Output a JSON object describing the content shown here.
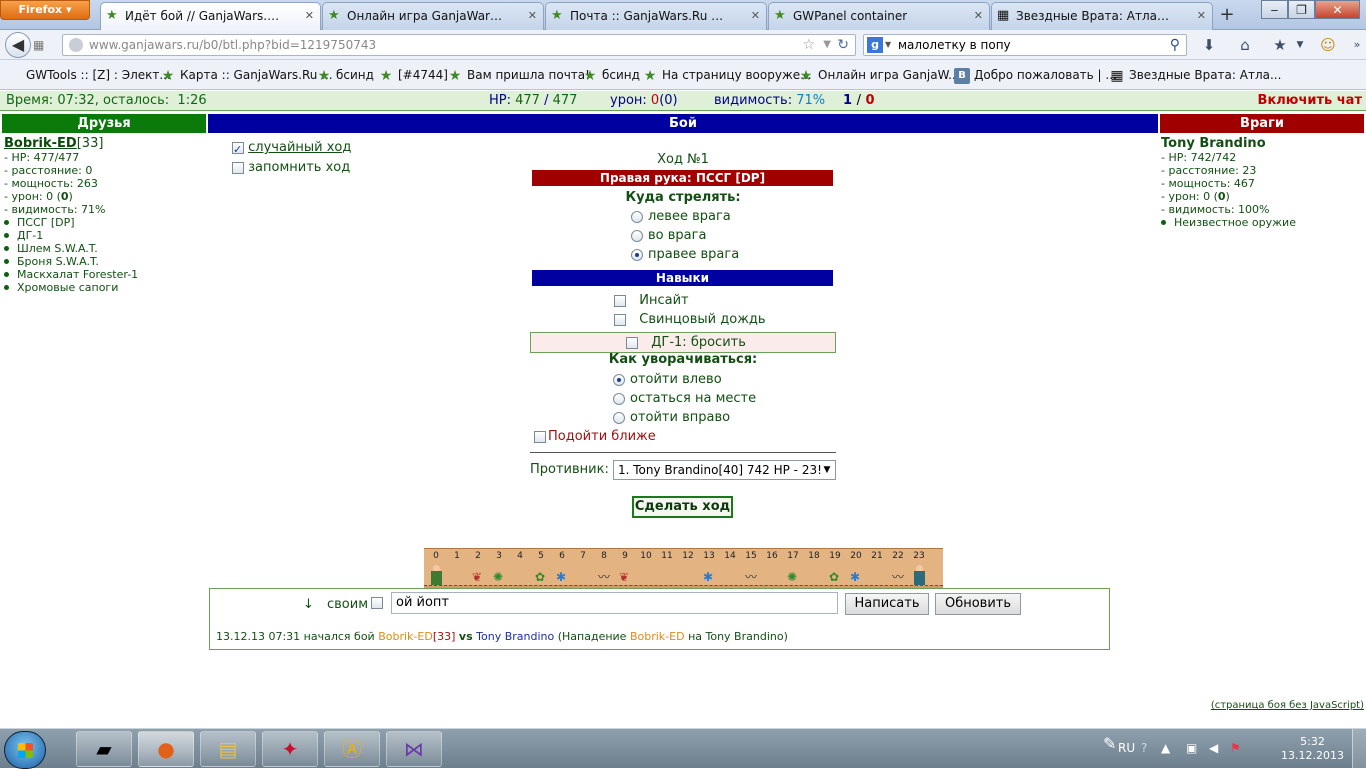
{
  "browser": {
    "menu_button": "Firefox",
    "tabs": [
      {
        "label": "Идёт бой // GanjaWars.Ru",
        "active": true
      },
      {
        "label": "Онлайн игра GanjaWars.Ru :: Г...",
        "active": false
      },
      {
        "label": "Почта :: GanjaWars.Ru :: Гандж...",
        "active": false
      },
      {
        "label": "GWPanel container",
        "active": false
      },
      {
        "label": "Звездные Врата: Атлантида 1,2,...",
        "active": false
      }
    ],
    "url": "www.ganjawars.ru/b0/btl.php?bid=1219750743",
    "search_engine": "g",
    "search_text": "малолетку в попу",
    "bookmarks": [
      {
        "label": "GWTools :: [Z] : Элект...",
        "icon": "page-icon"
      },
      {
        "label": "Карта :: GanjaWars.Ru ...",
        "icon": "star-icon"
      },
      {
        "label": "бсинд",
        "icon": "star-icon"
      },
      {
        "label": "[#4744]",
        "icon": "star-icon"
      },
      {
        "label": "Вам пришла почта!",
        "icon": "star-icon"
      },
      {
        "label": "бсинд",
        "icon": "star-icon"
      },
      {
        "label": "На страницу вооруже...",
        "icon": "star-icon"
      },
      {
        "label": "Онлайн игра GanjaW...",
        "icon": "star-icon"
      },
      {
        "label": "Добро пожаловать | ...",
        "icon": "vk-icon"
      },
      {
        "label": "Звездные Врата: Атла...",
        "icon": "film-icon"
      }
    ]
  },
  "status": {
    "time_label": "Время:",
    "time_value": "07:32",
    "remaining_label": ", осталось:",
    "remaining_value": "1:26",
    "hp_label": "HP:",
    "hp_current": "477",
    "hp_max": "477",
    "damage_label": "урон:",
    "damage_value": "0",
    "damage_extra": "(0)",
    "visibility_label": "видимость:",
    "visibility_value": "71%",
    "team_a": "1",
    "team_b": "0",
    "chat_toggle": "Включить чат"
  },
  "panels": {
    "friends": "Друзья",
    "battle": "Бой",
    "enemies": "Враги"
  },
  "friend": {
    "name": "Bobrik-ED",
    "level": "[33]",
    "stats": [
      "- HP: 477/477",
      "- расстояние: 0",
      "- мощность: 263"
    ],
    "damage": "- урон: 0 (",
    "damage_bold": "0",
    "damage_close": ")",
    "visibility": "- видимость: 71%",
    "items": [
      "ПССГ [DP]",
      "ДГ-1",
      "Шлем S.W.A.T.",
      "Броня S.W.A.T.",
      "Маскхалат Forester-1",
      "Хромовые сапоги"
    ]
  },
  "enemy": {
    "name": "Tony Brandino",
    "stats": [
      "- HP: 742/742",
      "- расстояние: 23",
      "- мощность: 467"
    ],
    "damage": "- урон: 0 (",
    "damage_bold": "0",
    "damage_close": ")",
    "visibility": "- видимость: 100%",
    "items": [
      "Неизвестное оружие"
    ]
  },
  "options": {
    "random_move": "случайный ход",
    "remember_move": "запомнить ход"
  },
  "turn": {
    "title": "Ход №1",
    "right_hand": "Правая рука: ПССГ [DP]",
    "shoot_title": "Куда стрелять:",
    "shoot_options": [
      "левее врага",
      "во врага",
      "правее врага"
    ],
    "shoot_selected": 2,
    "skills_title": "Навыки",
    "skills": [
      "Инсайт",
      "Свинцовый дождь"
    ],
    "grenade": "ДГ-1: бросить",
    "dodge_title": "Как уворачиваться:",
    "dodge_options": [
      "отойти влево",
      "остаться на месте",
      "отойти вправо"
    ],
    "dodge_selected": 0,
    "approach": "Подойти ближе",
    "opponent_label": "Противник:",
    "opponent_value": "1. Tony Brandino[40] 742 HP - 23!",
    "submit": "Сделать ход"
  },
  "field": {
    "cells": [
      "0",
      "1",
      "2",
      "3",
      "4",
      "5",
      "6",
      "7",
      "8",
      "9",
      "10",
      "11",
      "12",
      "13",
      "14",
      "15",
      "16",
      "17",
      "18",
      "19",
      "20",
      "21",
      "22",
      "23"
    ],
    "friend_cell": 0,
    "enemy_cell": 23
  },
  "chat": {
    "arrow": "↓",
    "own_label": "своим",
    "input_value": "ой йопт",
    "send_button": "Написать",
    "refresh_button": "Обновить",
    "log": {
      "date": "13.12.13 07:31 начался бой",
      "player_a": "Bobrik-ED",
      "player_a_level": "[33]",
      "vs": "vs",
      "player_b": "Tony Brandino",
      "attack_open": "(Нападение",
      "attacker": "Bobrik-ED",
      "on": "на",
      "defender": "Tony Brandino",
      "close": ")"
    }
  },
  "footer_link": "(страница боя без JavaScript)",
  "taskbar": {
    "language": "RU",
    "time": "5:32",
    "date": "13.12.2013"
  },
  "colors": {
    "friends_header": "#0a7a0a",
    "battle_header": "#0000a0",
    "enemies_header": "#a00000",
    "right_hand_bar": "#a00000",
    "skills_bar": "#0000a0"
  }
}
